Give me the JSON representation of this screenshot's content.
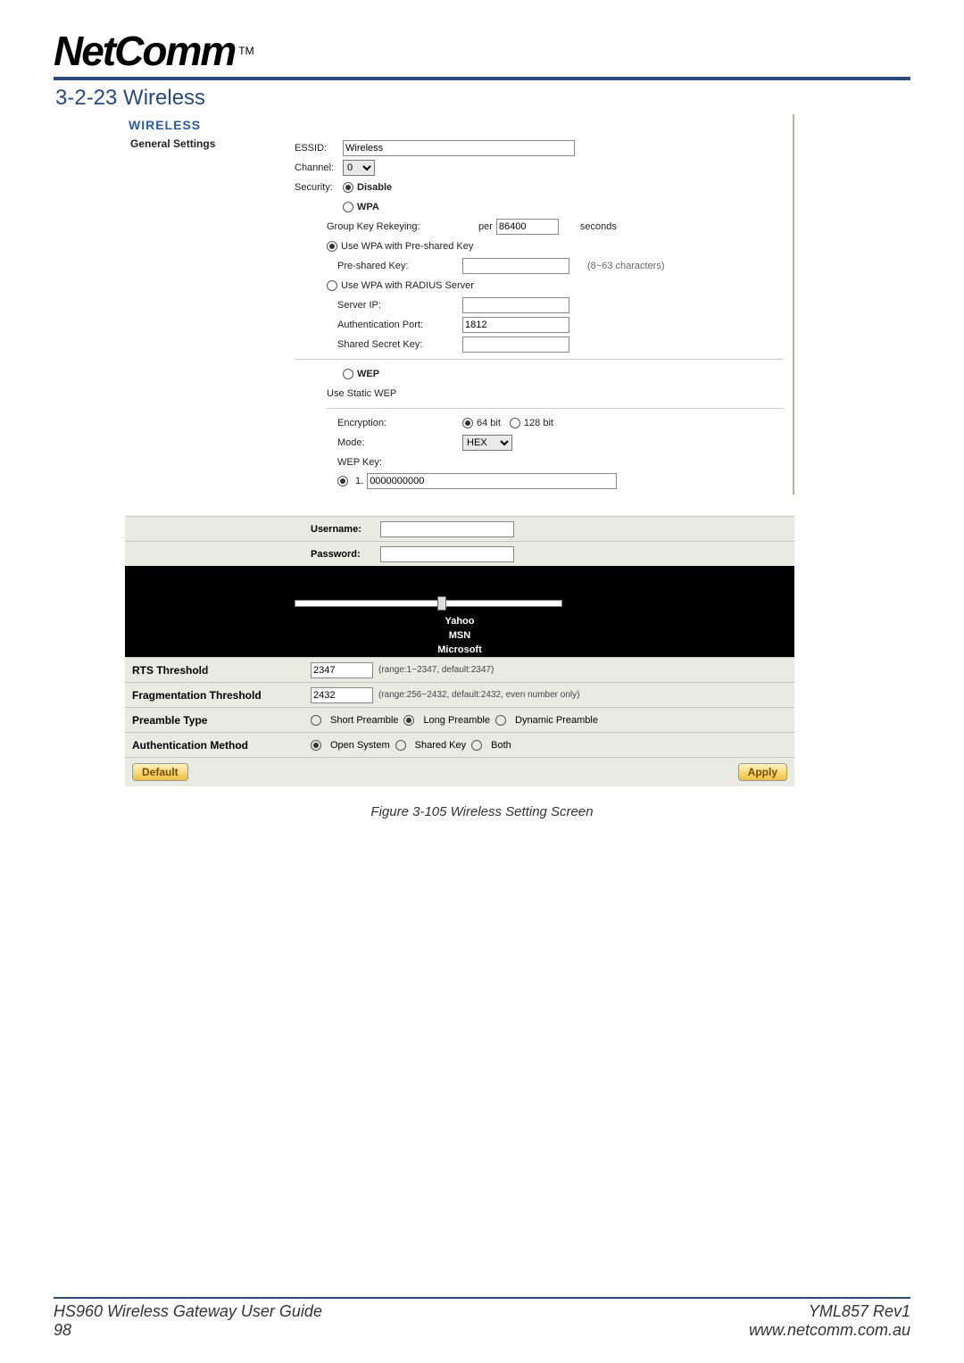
{
  "logo": {
    "text": "NetComm",
    "tm": "TM"
  },
  "section_title": "3-2-23 Wireless",
  "shot1": {
    "heading": "WIRELESS",
    "left_label": "General Settings",
    "essid": {
      "label": "ESSID:",
      "value": "Wireless"
    },
    "channel": {
      "label": "Channel:",
      "value": "0"
    },
    "security": {
      "label": "Security:",
      "disable": "Disable",
      "wpa": "WPA",
      "wep": "WEP",
      "gkr": {
        "label": "Group Key Rekeying:",
        "per": "per",
        "value": "86400",
        "unit": "seconds"
      },
      "psk_opt": "Use WPA with Pre-shared Key",
      "psk": {
        "label": "Pre-shared Key:",
        "hint": "(8~63 characters)"
      },
      "radius_opt": "Use WPA with RADIUS Server",
      "server_ip": "Server IP:",
      "auth_port": {
        "label": "Authentication Port:",
        "value": "1812"
      },
      "shared_secret": "Shared Secret Key:",
      "use_static_wep": "Use Static WEP",
      "encryption": {
        "label": "Encryption:",
        "o64": "64 bit",
        "o128": "128 bit"
      },
      "mode": {
        "label": "Mode:",
        "value": "HEX"
      },
      "wep_key_label": "WEP Key:",
      "wep_key_row": {
        "num": "1.",
        "value": "0000000000"
      }
    }
  },
  "shot2": {
    "username": "Username:",
    "password": "Password:",
    "links": {
      "yahoo": "Yahoo",
      "msn": "MSN",
      "microsoft": "Microsoft"
    },
    "rts": {
      "label": "RTS Threshold",
      "value": "2347",
      "hint": "(range:1~2347, default:2347)"
    },
    "frag": {
      "label": "Fragmentation Threshold",
      "value": "2432",
      "hint": "(range:256~2432, default:2432, even number only)"
    },
    "preamble": {
      "label": "Preamble Type",
      "short": "Short Preamble",
      "long": "Long Preamble",
      "dyn": "Dynamic Preamble"
    },
    "auth": {
      "label": "Authentication Method",
      "open": "Open System",
      "shared": "Shared Key",
      "both": "Both"
    },
    "buttons": {
      "default": "Default",
      "apply": "Apply"
    }
  },
  "caption": "Figure 3-105 Wireless Setting Screen",
  "footer": {
    "guide": "HS960 Wireless Gateway User Guide",
    "page": "98",
    "rev": "YML857 Rev1",
    "url": "www.netcomm.com.au"
  }
}
